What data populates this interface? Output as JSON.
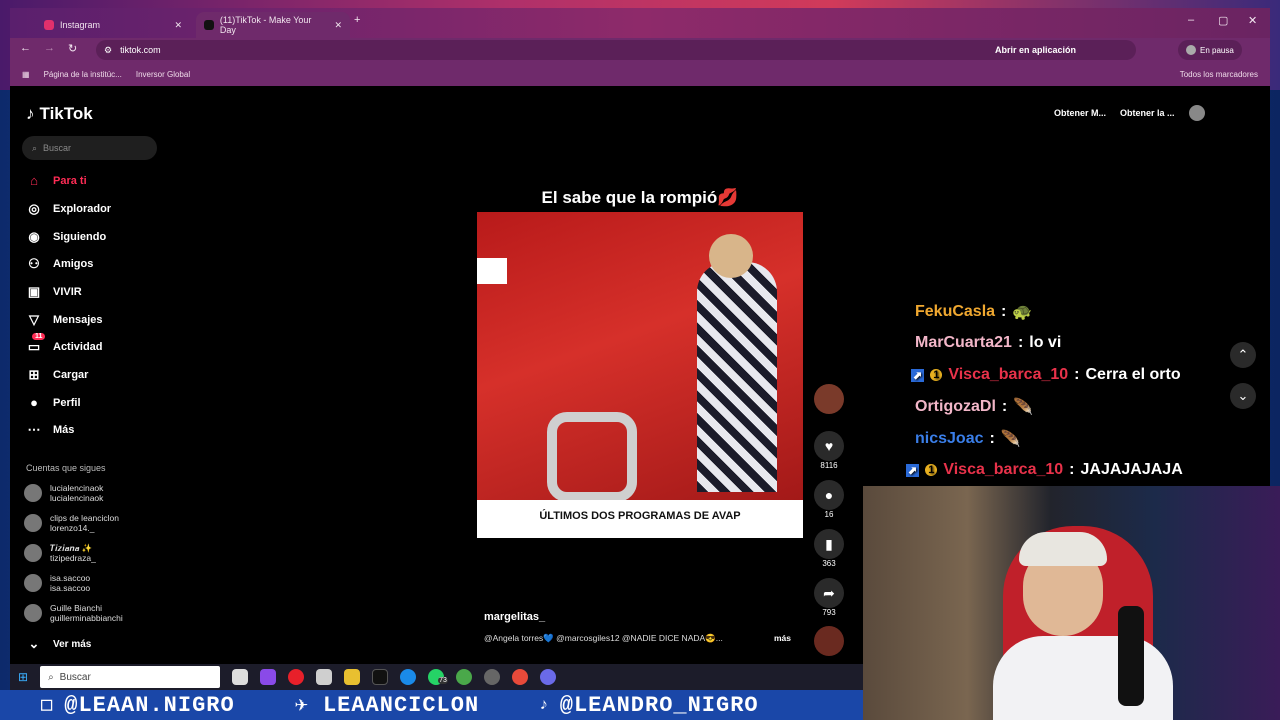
{
  "browser": {
    "tabs": [
      {
        "label": "Instagram"
      },
      {
        "label": "(11)TikTok - Make Your Day"
      }
    ],
    "url": "tiktok.com",
    "open_app": "Abrir en aplicación",
    "profile_status": "En pausa",
    "bookmarks": [
      "Página de la institúc...",
      "Inversor Global"
    ],
    "all_bookmarks": "Todos los marcadores"
  },
  "tiktok": {
    "logo": "TikTok",
    "search_placeholder": "Buscar",
    "nav": [
      {
        "label": "Para ti",
        "icon": "home-icon"
      },
      {
        "label": "Explorador",
        "icon": "compass-icon"
      },
      {
        "label": "Siguiendo",
        "icon": "following-icon"
      },
      {
        "label": "Amigos",
        "icon": "friends-icon"
      },
      {
        "label": "VIVIR",
        "icon": "live-icon"
      },
      {
        "label": "Mensajes",
        "icon": "messages-icon"
      },
      {
        "label": "Actividad",
        "icon": "activity-icon",
        "badge": "11"
      },
      {
        "label": "Cargar",
        "icon": "upload-icon"
      },
      {
        "label": "Perfil",
        "icon": "profile-icon"
      },
      {
        "label": "Más",
        "icon": "more-icon"
      }
    ],
    "following_title": "Cuentas que sigues",
    "accounts": [
      {
        "name": "lucialencinaok",
        "user": "lucialencinaok"
      },
      {
        "name": "clips de leanciclon",
        "user": "lorenzo14._"
      },
      {
        "name": "𝑻𝒊𝒛𝒊𝒂𝒏𝒂 ✨",
        "user": "tizipedraza_"
      },
      {
        "name": "isa.saccoo",
        "user": "isa.saccoo"
      },
      {
        "name": "Guille Bianchi",
        "user": "guillerminabbianchi"
      }
    ],
    "see_more": "Ver más",
    "top_buttons": [
      "Obtener M...",
      "Obtener la ..."
    ],
    "video": {
      "title": "El sabe que la rompió💋",
      "caption_bar": "ÚLTIMOS DOS PROGRAMAS DE AVAP",
      "username": "margelitas_",
      "description": "@Angela torres💙 @marcosgiles12 @NADIE DICE NADA😎...",
      "more": "más",
      "likes": "8116",
      "comments": "16",
      "saves": "363",
      "shares": "793"
    }
  },
  "chat": [
    {
      "user": "FekuCasla",
      "msg": "🐢",
      "color": "#f0a830"
    },
    {
      "user": "MarCuarta21",
      "msg": "lo vi",
      "color": "#f2b6c8"
    },
    {
      "user": "Visca_barca_10",
      "msg": "Cerra el orto",
      "color": "#e8324a"
    },
    {
      "user": "OrtigozaDl",
      "msg": "🪶",
      "color": "#f2b6c8"
    },
    {
      "user": "nicsJoac",
      "msg": "🪶",
      "color": "#3a7ee8"
    },
    {
      "user": "Visca_barca_10",
      "msg": "JAJAJAJAJA",
      "color": "#e8324a"
    }
  ],
  "taskbar": {
    "search": "Buscar",
    "whatsapp_badge": "73"
  },
  "banner": [
    "@LEAAN.NIGRO",
    "LEAANCICLON",
    "@LEANDRO_NIGRO"
  ]
}
